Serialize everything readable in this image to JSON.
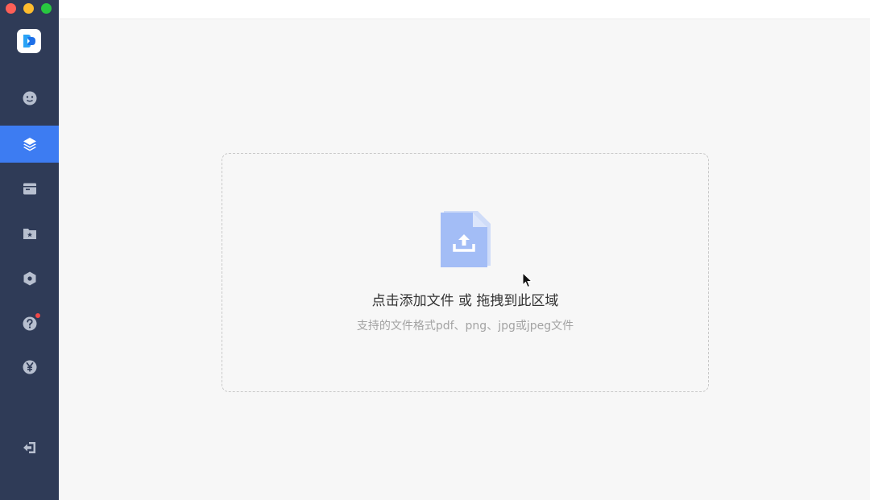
{
  "window": {
    "controls": [
      "close",
      "minimize",
      "maximize"
    ]
  },
  "sidebar": {
    "logo": "app-logo",
    "items": [
      {
        "icon": "face-icon",
        "active": false
      },
      {
        "icon": "layers-icon",
        "active": true
      },
      {
        "icon": "calendar-icon",
        "active": false
      },
      {
        "icon": "folder-star-icon",
        "active": false
      },
      {
        "icon": "hexagon-icon",
        "active": false
      },
      {
        "icon": "help-icon",
        "active": false,
        "badge": true
      },
      {
        "icon": "yen-icon",
        "active": false
      },
      {
        "icon": "logout-icon",
        "active": false
      }
    ],
    "bg_color": "#2f3b57",
    "active_color": "#3d7cf2"
  },
  "upload": {
    "icon": "file-upload-icon",
    "main_text": "点击添加文件 或 拖拽到此区域",
    "sub_text": "支持的文件格式pdf、png、jpg或jpeg文件"
  }
}
